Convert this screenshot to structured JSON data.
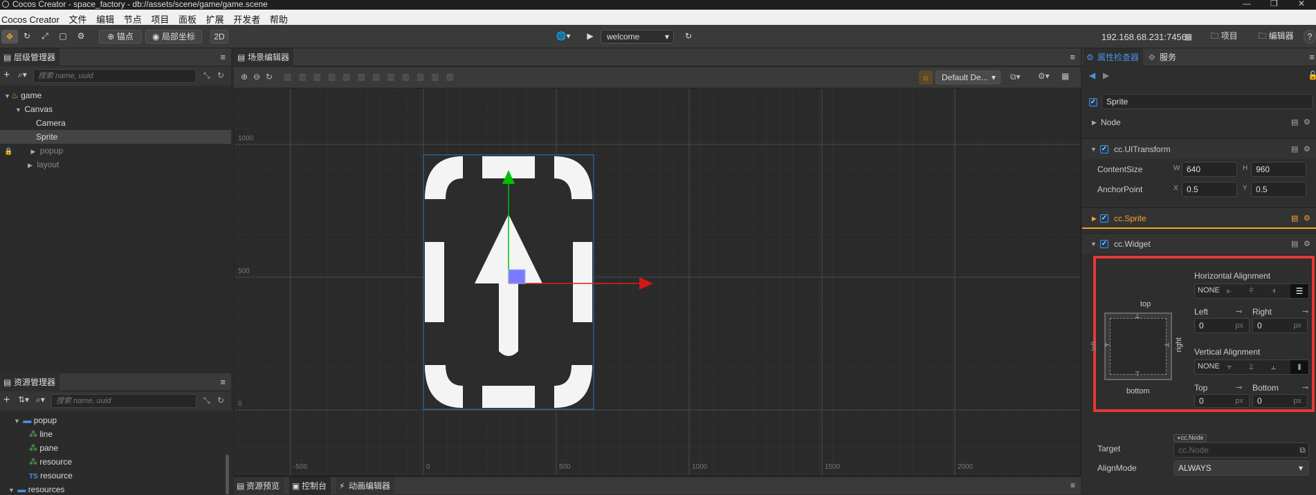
{
  "window": {
    "title": "Cocos Creator - space_factory - db://assets/scene/game/game.scene"
  },
  "menu": [
    "Cocos Creator",
    "文件",
    "编辑",
    "节点",
    "项目",
    "面板",
    "扩展",
    "开发者",
    "帮助"
  ],
  "toolbar": {
    "pivot_label": "锚点",
    "local_label": "局部坐标",
    "mode_2d": "2D",
    "scene_select": "welcome",
    "ip": "192.168.68.231:7456",
    "project_label": "项目",
    "editor_label": "编辑器"
  },
  "hierarchy": {
    "title": "层级管理器",
    "search_placeholder": "搜索 name, uuid",
    "nodes": [
      {
        "label": "game",
        "level": 0
      },
      {
        "label": "Canvas",
        "level": 1
      },
      {
        "label": "Camera",
        "level": 2
      },
      {
        "label": "Sprite",
        "level": 2,
        "selected": true
      },
      {
        "label": "popup",
        "level": 2,
        "dim": true
      },
      {
        "label": "layout",
        "level": 2,
        "dim": true
      }
    ]
  },
  "assets": {
    "title": "资源管理器",
    "search_placeholder": "搜索 name, uuid",
    "items": [
      {
        "label": "popup",
        "type": "folder"
      },
      {
        "label": "line",
        "type": "prefab"
      },
      {
        "label": "pane",
        "type": "prefab"
      },
      {
        "label": "resource",
        "type": "prefab"
      },
      {
        "label": "resource",
        "type": "ts"
      },
      {
        "label": "resources",
        "type": "folder"
      }
    ]
  },
  "scene_editor": {
    "title": "场景编辑器",
    "camera_select": "Default De...",
    "y_labels": [
      "1000",
      "500",
      "0"
    ],
    "x_labels": [
      "-500",
      "0",
      "500",
      "1000",
      "1500",
      "2000"
    ]
  },
  "bottom_tabs": [
    "资源预览",
    "控制台",
    "动画编辑器"
  ],
  "inspector": {
    "tab_properties": "属性检查器",
    "tab_services": "服务",
    "node_name": "Sprite",
    "node_section": "Node",
    "components": {
      "uitransform": "cc.UITransform",
      "sprite": "cc.Sprite",
      "widget": "cc.Widget"
    },
    "content_size_label": "ContentSize",
    "width_key": "W",
    "width": "640",
    "height_key": "H",
    "height": "960",
    "anchor_label": "AnchorPoint",
    "anchor_x_key": "X",
    "anchor_x": "0.5",
    "anchor_y_key": "Y",
    "anchor_y": "0.5",
    "widget": {
      "top_label": "top",
      "bottom_label": "bottom",
      "left_label": "left",
      "right_label": "right",
      "h_align_label": "Horizontal Alignment",
      "v_align_label": "Vertical Alignment",
      "none_label": "NONE",
      "left_field_label": "Left",
      "right_field_label": "Right",
      "top_field_label": "Top",
      "bottom_field_label": "Bottom",
      "left_value": "0",
      "right_value": "0",
      "top_value": "0",
      "bottom_value": "0",
      "unit": "px",
      "target_label": "Target",
      "target_badge": "cc.Node",
      "target_placeholder": "cc.Node",
      "align_mode_label": "AlignMode",
      "align_mode": "ALWAYS"
    }
  },
  "colors": {
    "accent": "#4a90e2",
    "highlight": "#f5a623",
    "red_frame": "#e53935"
  }
}
